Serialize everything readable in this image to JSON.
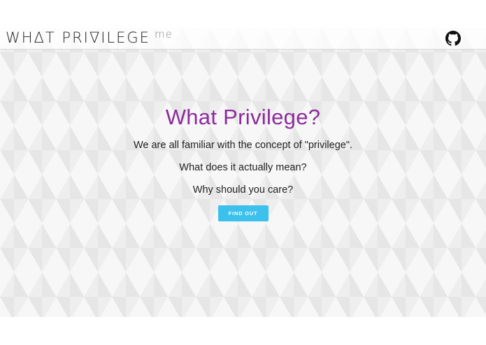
{
  "navbar": {
    "logo_text": "WHΔT PRI∇ILEGE",
    "logo_tld": "me",
    "github_icon": "github-icon"
  },
  "hero": {
    "title": "What Privilege?",
    "line1": "We are all familiar with the concept of \"privilege\".",
    "line2": "What does it actually mean?",
    "line3": "Why should you care?",
    "button_label": "FIND OUT"
  },
  "colors": {
    "title": "#8e2b9c",
    "button": "#3cc0ec",
    "text": "#222222"
  }
}
